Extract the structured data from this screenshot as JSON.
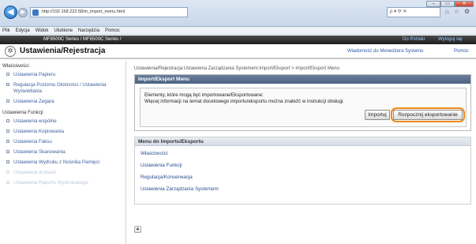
{
  "browser": {
    "url": "http://192.168.222.58/m_import_menu.html",
    "search_placeholder": "ρ ▾ ⟳ ✕",
    "window_buttons": {
      "minimize": "‒",
      "maximize": "▭",
      "close": "✕"
    },
    "toolbar_icons": {
      "home": "⌂",
      "favorites": "☆",
      "settings": "⚙"
    },
    "menu": [
      "Plik",
      "Edycja",
      "Widok",
      "Ulubione",
      "Narzędzia",
      "Pomoc"
    ]
  },
  "device_bar": {
    "name": "MF8500C Series / MF8500C Series /",
    "portal": "Do Portalu",
    "logout": "Wyloguj się"
  },
  "header": {
    "title": "Ustawienia/Rejestracja",
    "messages_link": "Wiadomość do Menedżera Systemu",
    "help_link": "Pomoc"
  },
  "sidebar": {
    "sections": [
      {
        "title": "Właściwości",
        "items": [
          "Ustawienia Papieru",
          "Regulacja Poziomu Głośności / Ustawienia Wyświetlania",
          "Ustawienia Zegara"
        ]
      },
      {
        "title": "Ustawienia Funkcji",
        "items": [
          "Ustawienia wspólne",
          "Ustawienia Kopiowania",
          "Ustawienia Faksu",
          "Ustawienia Skanowania",
          "Ustawienia Wydruku z Nośnika Pamięci",
          "Ustawienia drukarki",
          "Ustawienia Raportu Wydrukowego"
        ]
      }
    ]
  },
  "main": {
    "breadcrumb": "Ustawienia/Rejestracja:Ustawienia Zarządzania Systemem:Import/Eksport > Import/Eksport Menu",
    "panel_title": "Import/Eksport Menu",
    "description_line1": "Elementy, które mogą być importowane/Eksportowane:",
    "description_line2": "Więcej informacji na temat docelowego importu/eksportu można znaleźć w instrukcji obsługi.",
    "import_button": "Importuj",
    "export_button": "Rozpocznij eksportowanie",
    "menu_panel_title": "Menu do Importu/Eksportu",
    "menu_items": [
      "Właściwości",
      "Ustawienia Funkcji",
      "Regulacja/Konserwacja",
      "Ustawienia Zarządzania Systemem"
    ],
    "to_top": "▲"
  }
}
